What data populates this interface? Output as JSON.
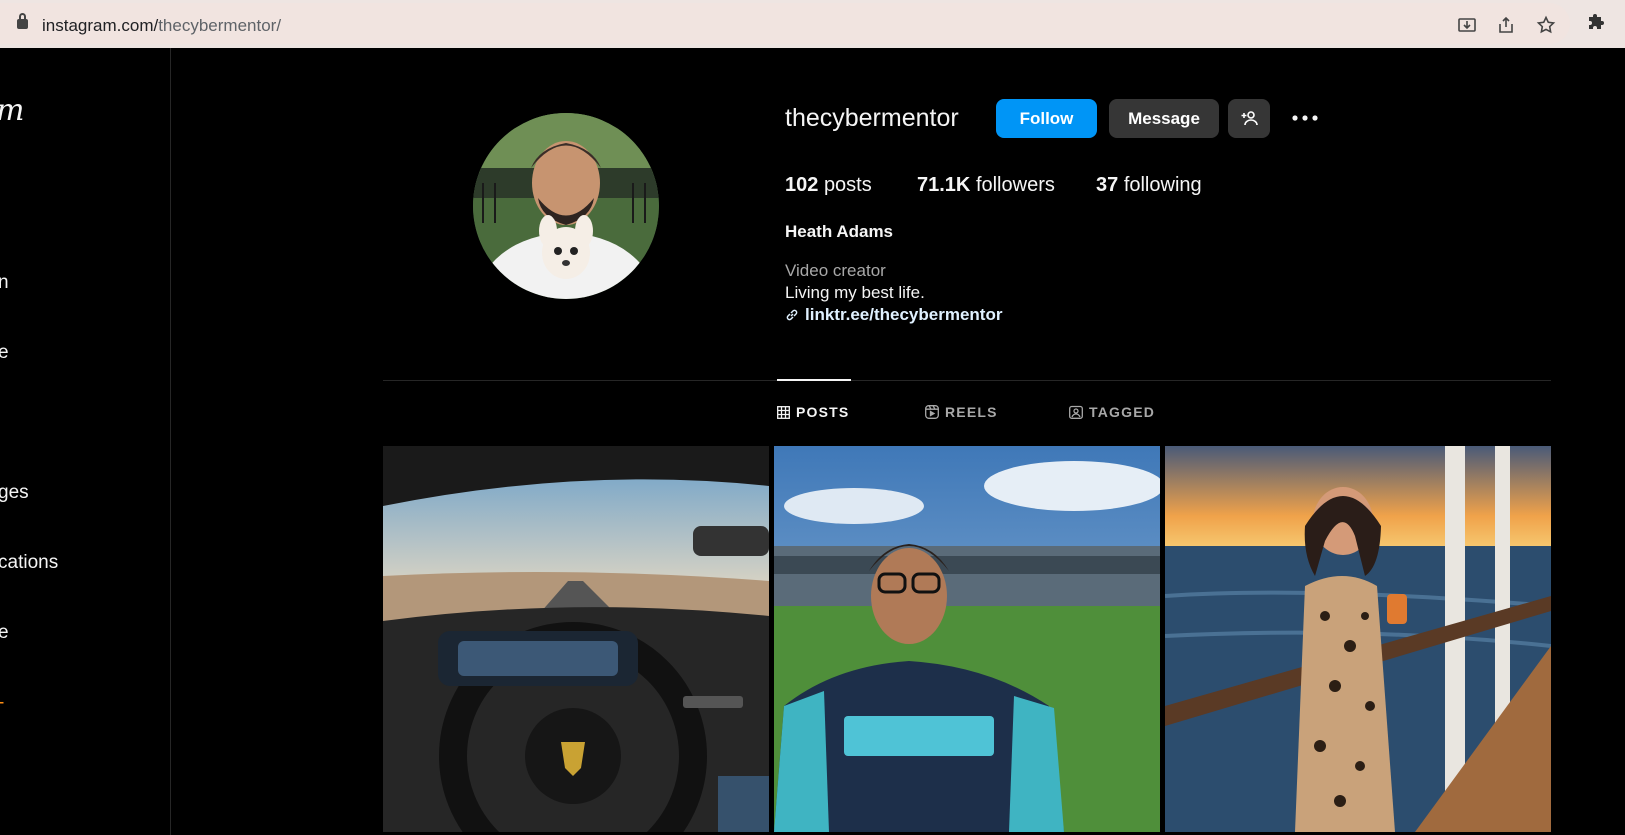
{
  "browser": {
    "url_host": "instagram.com/",
    "url_path": "thecybermentor/",
    "icons": [
      "lock-icon",
      "install-icon",
      "share-icon",
      "bookmark-star-icon",
      "extensions-icon"
    ]
  },
  "sidebar": {
    "logo_text": "m",
    "items": [
      {
        "label": "n"
      },
      {
        "label": "e"
      },
      {
        "label": "ges"
      },
      {
        "label": "cations"
      },
      {
        "label": "e"
      },
      {
        "label": "-"
      }
    ]
  },
  "profile": {
    "username": "thecybermentor",
    "follow_label": "Follow",
    "message_label": "Message",
    "posts_count": "102",
    "posts_label": "posts",
    "followers_count": "71.1K",
    "followers_label": "followers",
    "following_count": "37",
    "following_label": "following",
    "full_name": "Heath Adams",
    "category": "Video creator",
    "bio": "Living my best life.",
    "link": "linktr.ee/thecybermentor"
  },
  "tabs": [
    {
      "label": "POSTS",
      "active": true
    },
    {
      "label": "REELS",
      "active": false
    },
    {
      "label": "TAGGED",
      "active": false
    }
  ],
  "posts": [
    {
      "subject": "car-interior-desert-road"
    },
    {
      "subject": "man-baseball-jersey-stadium"
    },
    {
      "subject": "woman-ship-deck-sunset"
    }
  ],
  "colors": {
    "accent": "#0095f6",
    "secondary_button": "#363636",
    "background": "#000000",
    "text": "#f5f5f5",
    "muted": "#a8a8a8",
    "address_bar": "#f1e4e0"
  }
}
